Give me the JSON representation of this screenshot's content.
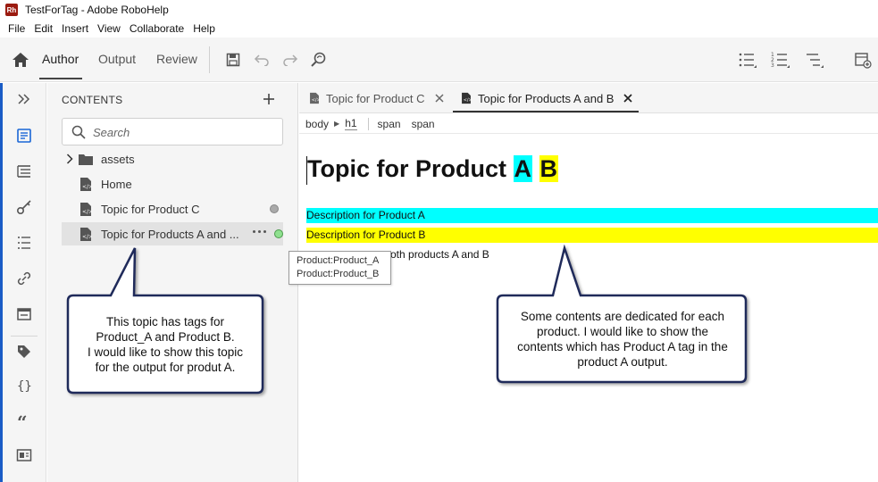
{
  "window": {
    "title": "TestForTag - Adobe RoboHelp",
    "logo_text": "Rh"
  },
  "menu": [
    "File",
    "Edit",
    "Insert",
    "View",
    "Collaborate",
    "Help"
  ],
  "toolbar": {
    "tabs": {
      "author": "Author",
      "output": "Output",
      "review": "Review"
    },
    "active_tab": "Author"
  },
  "contents": {
    "title": "CONTENTS",
    "search_placeholder": "Search",
    "tree": [
      {
        "label": "assets",
        "type": "folder",
        "expandable": true
      },
      {
        "label": "Home",
        "type": "topic"
      },
      {
        "label": "Topic for Product C",
        "type": "topic",
        "status": "gray"
      },
      {
        "label": "Topic for Products A and ...",
        "type": "topic",
        "status": "green",
        "selected": true
      }
    ]
  },
  "editor": {
    "tabs": [
      {
        "label": "Topic for Product C",
        "active": false
      },
      {
        "label": "Topic for Products A and B",
        "active": true
      }
    ],
    "breadcrumb": {
      "body": "body",
      "h1": "h1",
      "span1": "span",
      "span2": "span"
    },
    "heading": {
      "prefix": "Topic for Product ",
      "a": "A",
      "b": "B"
    },
    "desc_a": "Description for Product A",
    "desc_b": "Description for Product B",
    "paragraph_visible": "oth products A and B"
  },
  "tooltip": {
    "line1": "Product:Product_A",
    "line2": "Product:Product_B"
  },
  "callouts": {
    "left": [
      "This topic has tags for",
      "Product_A and Product B.",
      "I would like to show this topic",
      "for the output for produt A."
    ],
    "right": [
      "Some contents are dedicated for each",
      "product. I would like to show the",
      "contents which has Product A tag in the",
      "product A output."
    ]
  },
  "colors": {
    "highlight_a": "#00ffff",
    "highlight_b": "#ffff00",
    "rail_accent": "#1a5cc6",
    "callout_border": "#1f2a5a",
    "status_green": "#8fe08f",
    "status_gray": "#a9a9a9"
  }
}
